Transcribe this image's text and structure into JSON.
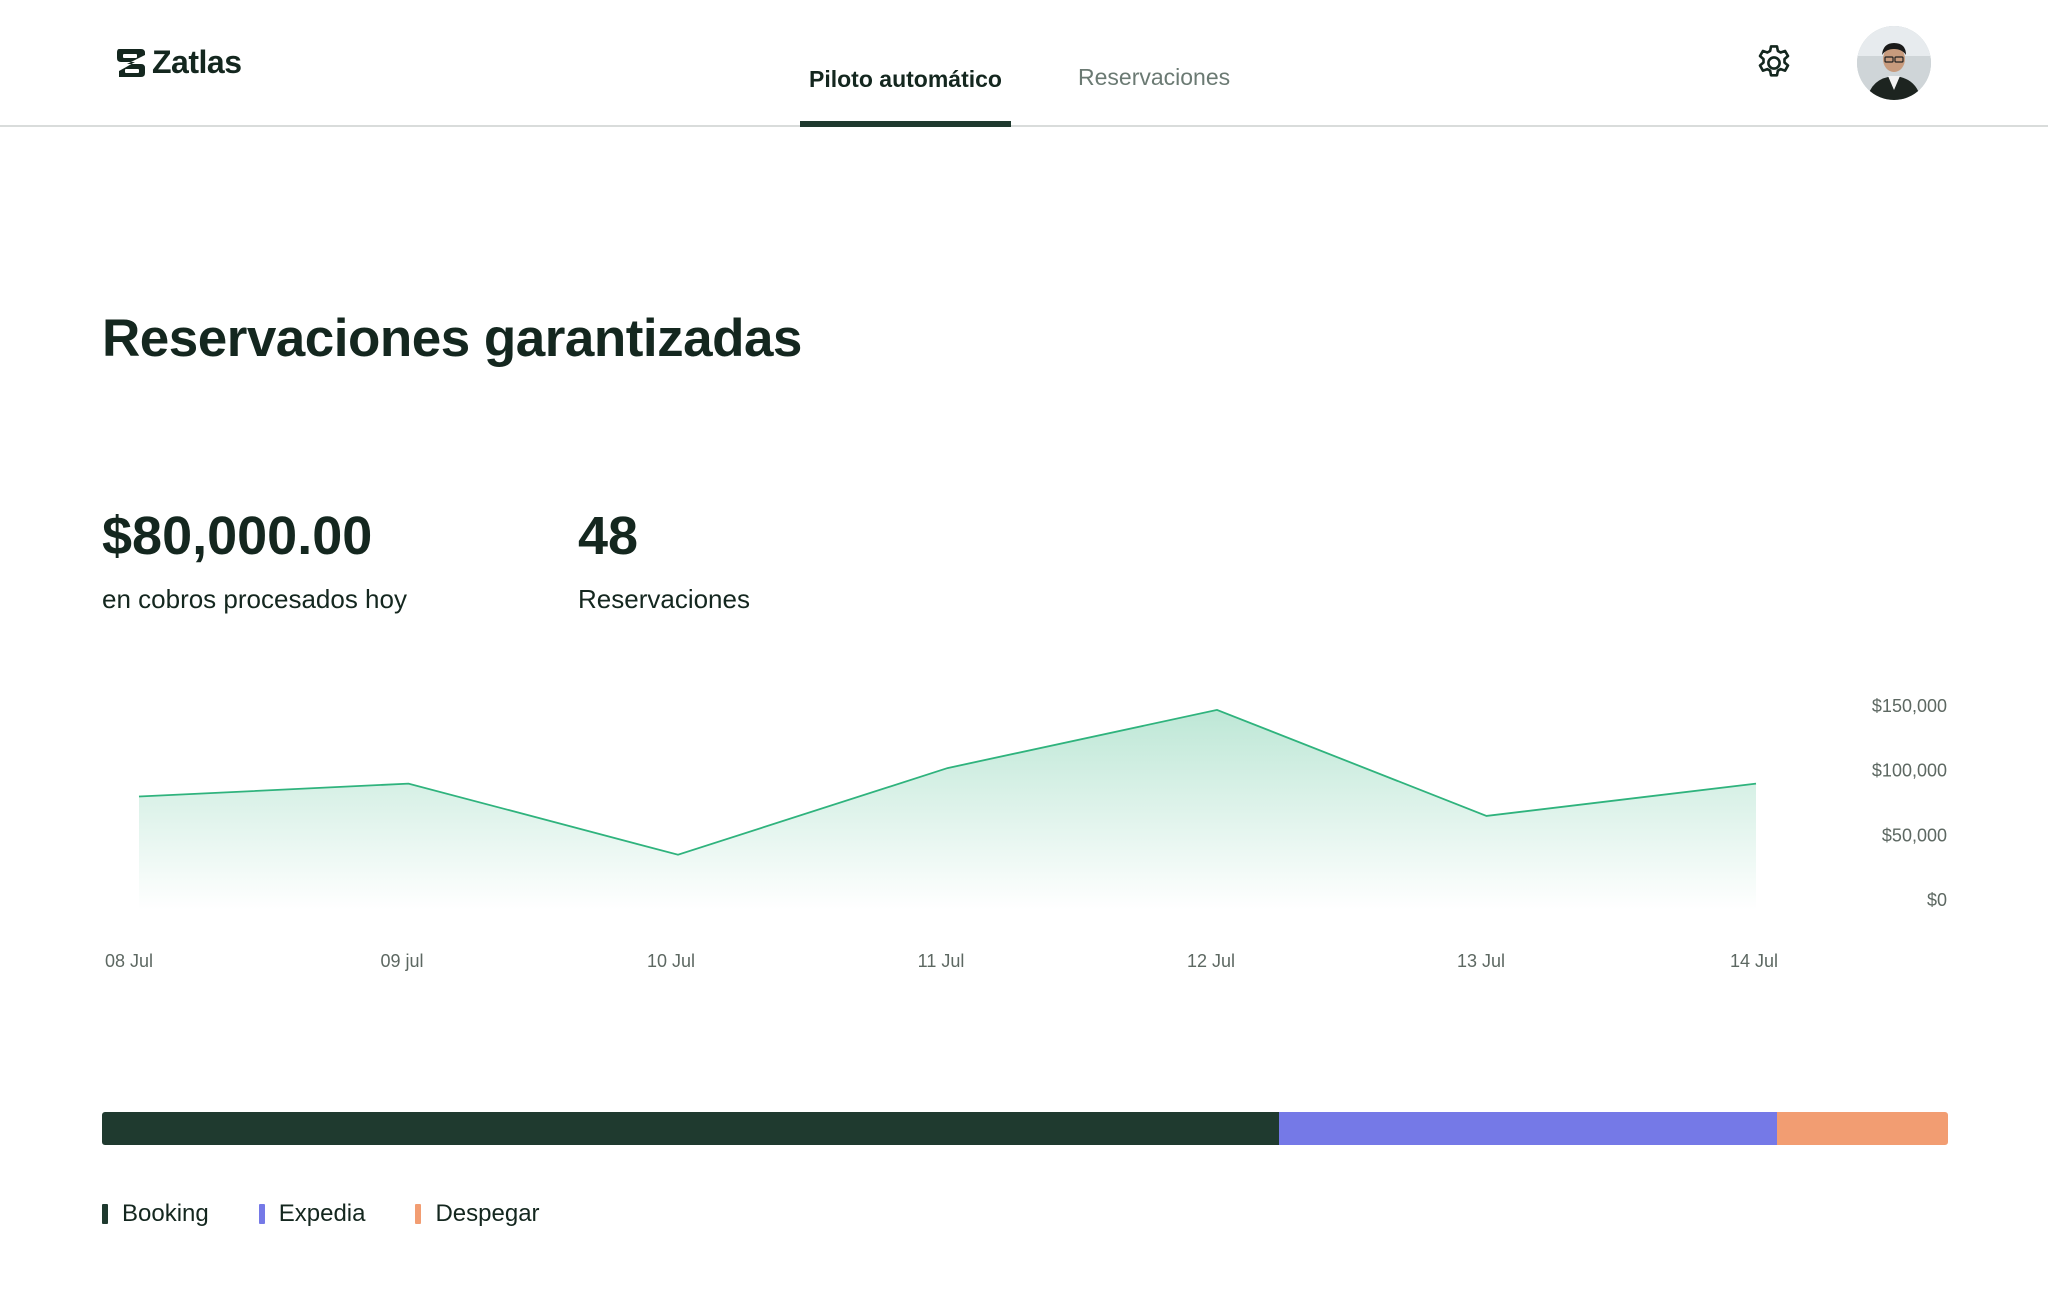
{
  "header": {
    "brand": "Zatlas",
    "tabs": [
      {
        "label": "Piloto automático",
        "active": true
      },
      {
        "label": "Reservaciones",
        "active": false
      }
    ],
    "icons": {
      "settings": "gear-icon",
      "profile": "avatar"
    }
  },
  "main": {
    "title": "Reservaciones garantizadas",
    "metrics": [
      {
        "value": "$80,000.00",
        "label": "en cobros procesados hoy"
      },
      {
        "value": "48",
        "label": "Reservaciones"
      }
    ]
  },
  "chart_data": {
    "type": "area",
    "x": [
      "08 Jul",
      "09 jul",
      "10 Jul",
      "11 Jul",
      "12 Jul",
      "13 Jul",
      "14 Jul"
    ],
    "series": [
      {
        "values": [
          80000,
          90000,
          35000,
          102000,
          147000,
          65000,
          90000
        ]
      }
    ],
    "yticks": [
      "$150,000",
      "$100,000",
      "$50,000",
      "$0"
    ],
    "ylim": [
      0,
      150000
    ],
    "grid": false,
    "color": "#2fb37d"
  },
  "channels": {
    "items": [
      {
        "name": "Booking",
        "share": 0.6375,
        "color": "#1f3a2f"
      },
      {
        "name": "Expedia",
        "share": 0.27,
        "color": "#7579e7"
      },
      {
        "name": "Despegar",
        "share": 0.0925,
        "color": "#f29d72"
      }
    ]
  }
}
